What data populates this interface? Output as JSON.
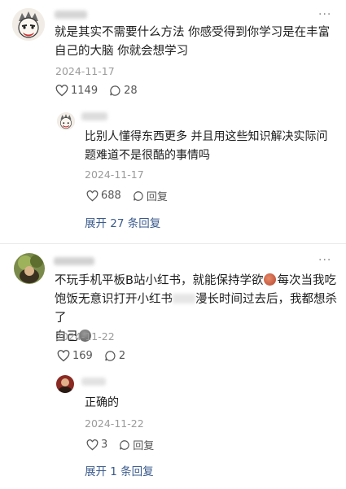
{
  "comments": [
    {
      "text_line1": "就是其实不需要什么方法 你感受得到你学习是在丰富",
      "text_line2": "自己的大脑 你就会想学习",
      "date": "2024-11-17",
      "likes": "1149",
      "replies_count": "28",
      "more": "···"
    },
    {
      "reply_text_line1": "比别人懂得东西更多 并且用这些知识解决实际问",
      "reply_text_line2": "题难道不是很酷的事情吗",
      "reply_date": "2024-11-17",
      "reply_likes": "688",
      "reply_label": "回复",
      "expand_label": "展开 27 条回复"
    },
    {
      "text_line1_a": "不玩手机平板B站小红书，就能保持学欲",
      "text_line1_b": "每次当我吃",
      "text_line2_a": "饱饭无意识打开小红书",
      "text_line2_b": "漫长时间过去后，我都想杀了",
      "text_line3": "自己",
      "date": "2024-11-22",
      "likes": "169",
      "replies_count": "2",
      "more": "···"
    },
    {
      "reply_text": "正确的",
      "reply_date": "2024-11-22",
      "reply_likes": "3",
      "reply_label": "回复",
      "expand_label": "展开 1 条回复"
    }
  ],
  "icons": {
    "like": "heart-outline-icon",
    "reply": "speech-bubble-icon",
    "more": "more-dots-icon"
  },
  "colors": {
    "link": "#3a5a8c",
    "meta": "#9a9a9a",
    "reply_bg": "#f5f6f8"
  }
}
